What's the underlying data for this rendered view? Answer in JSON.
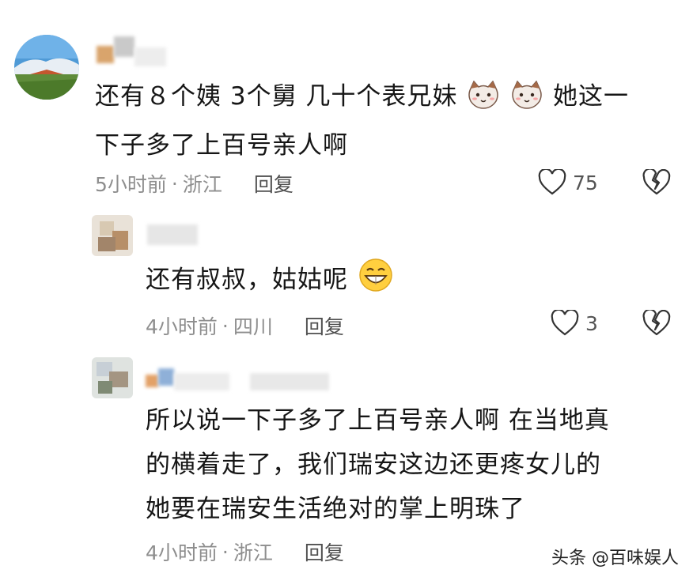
{
  "comments": [
    {
      "text_line1": "还有８个姨 3个舅 几十个表兄妹",
      "text_line1_tail": "她这一",
      "text_line2": "下子多了上百号亲人啊",
      "time": "5小时前",
      "location": "浙江",
      "reply_label": "回复",
      "like_count": "75"
    },
    {
      "text": "还有叔叔，姑姑呢",
      "time": "4小时前",
      "location": "四川",
      "reply_label": "回复",
      "like_count": "3"
    },
    {
      "text_line1": "所以说一下子多了上百号亲人啊 在当地真",
      "text_line2": "的横着走了，我们瑞安这边还更疼女儿的",
      "text_line3": "她要在瑞安生活绝对的掌上明珠了",
      "time": "4小时前",
      "location": "浙江",
      "reply_label": "回复"
    }
  ],
  "meta_separator": "·",
  "watermark": "头条 @百味娱人",
  "icons": {
    "like": "heart-outline-icon",
    "dislike": "broken-heart-icon",
    "emoji_cat": "cat-face-emoji",
    "emoji_grin": "grinning-face-emoji"
  }
}
